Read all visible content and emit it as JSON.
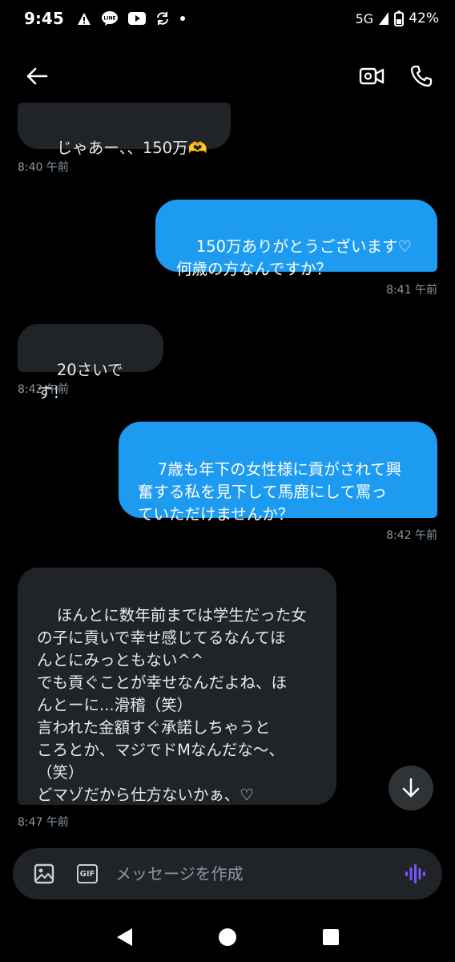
{
  "status_bar": {
    "time": "9:45",
    "network": "5G",
    "battery": "42%",
    "icons": [
      "warning-icon",
      "line-app-icon",
      "youtube-icon",
      "sync-icon",
      "dot-icon",
      "signal-icon",
      "battery-icon"
    ]
  },
  "header": {
    "icons": [
      "back-arrow-icon",
      "video-call-icon",
      "phone-call-icon"
    ]
  },
  "messages": [
    {
      "direction": "in",
      "text": "じゃあー、、150万🫶",
      "time": "8:40 午前"
    },
    {
      "direction": "out",
      "text": "150万ありがとうございます♡\n何歳の方なんですか？",
      "time": "8:41 午前"
    },
    {
      "direction": "in",
      "text": "20さいです！",
      "time": "8:42 午前"
    },
    {
      "direction": "out",
      "text": "7歳も年下の女性様に貢がされて興\n奮する私を見下して馬鹿にして罵っ\nていただけませんか？",
      "time": "8:42 午前"
    },
    {
      "direction": "in",
      "text": "ほんとに数年前までは学生だった女\nの子に貢いで幸せ感じてるなんてほ\nんとにみっともない^^\nでも貢ぐことが幸せなんだよね、ほ\nんとーに...滑稽（笑）\n言われた金額すぐ承諾しちゃうと\nころとか、マジでドMなんだな〜、\n（笑）\nどマゾだから仕方ないかぁ、♡",
      "time": "8:47 午前"
    }
  ],
  "composer": {
    "placeholder": "メッセージを作成",
    "gif_label": "GIF",
    "icons": [
      "image-icon",
      "gif-icon",
      "voice-icon"
    ]
  },
  "colors": {
    "background": "#000000",
    "incoming_bubble": "#202327",
    "outgoing_bubble": "#1d9bf0",
    "timestamp": "#8b98a5",
    "voice_accent": "#7856ff"
  }
}
